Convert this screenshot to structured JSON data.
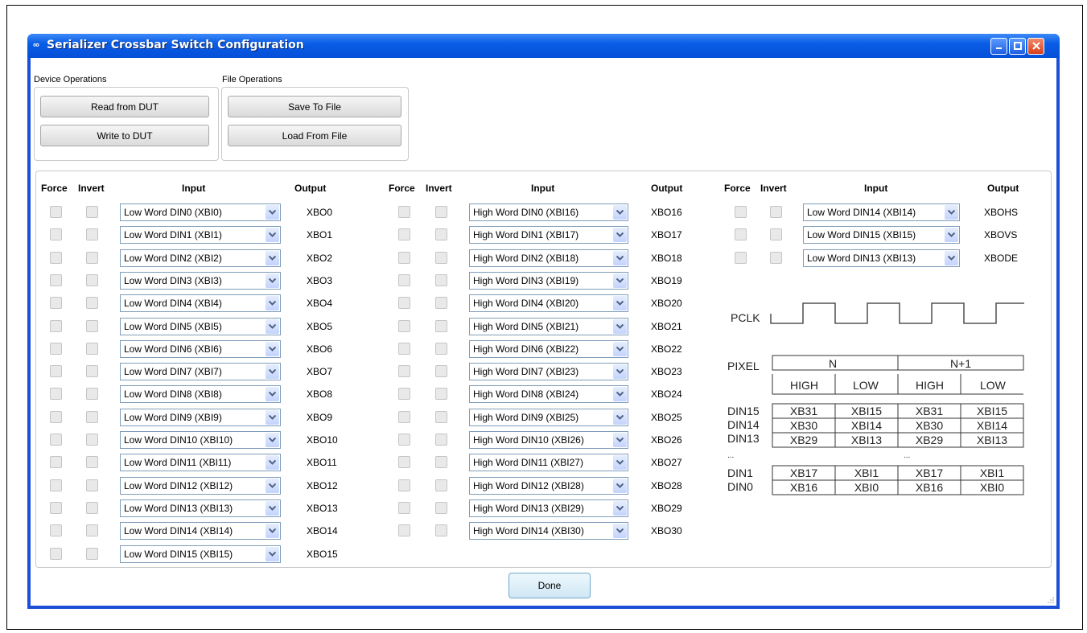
{
  "window": {
    "title": "Serializer Crossbar Switch Configuration"
  },
  "device_ops": {
    "label": "Device Operations",
    "read": "Read from DUT",
    "write": "Write to DUT"
  },
  "file_ops": {
    "label": "File Operations",
    "save": "Save To File",
    "load": "Load From File"
  },
  "headers": {
    "force": "Force",
    "invert": "Invert",
    "input": "Input",
    "output": "Output"
  },
  "col1": [
    {
      "input": "Low Word DIN0 (XBI0)",
      "output": "XBO0"
    },
    {
      "input": "Low Word DIN1 (XBI1)",
      "output": "XBO1"
    },
    {
      "input": "Low Word DIN2 (XBI2)",
      "output": "XBO2"
    },
    {
      "input": "Low Word DIN3 (XBI3)",
      "output": "XBO3"
    },
    {
      "input": "Low Word DIN4 (XBI4)",
      "output": "XBO4"
    },
    {
      "input": "Low Word DIN5 (XBI5)",
      "output": "XBO5"
    },
    {
      "input": "Low Word DIN6 (XBI6)",
      "output": "XBO6"
    },
    {
      "input": "Low Word DIN7 (XBI7)",
      "output": "XBO7"
    },
    {
      "input": "Low Word DIN8 (XBI8)",
      "output": "XBO8"
    },
    {
      "input": "Low Word DIN9 (XBI9)",
      "output": "XBO9"
    },
    {
      "input": "Low Word DIN10 (XBI10)",
      "output": "XBO10"
    },
    {
      "input": "Low Word DIN11 (XBI11)",
      "output": "XBO11"
    },
    {
      "input": "Low Word DIN12 (XBI12)",
      "output": "XBO12"
    },
    {
      "input": "Low Word DIN13 (XBI13)",
      "output": "XBO13"
    },
    {
      "input": "Low Word DIN14 (XBI14)",
      "output": "XBO14"
    },
    {
      "input": "Low Word DIN15 (XBI15)",
      "output": "XBO15"
    }
  ],
  "col2": [
    {
      "input": "High Word DIN0 (XBI16)",
      "output": "XBO16"
    },
    {
      "input": "High Word DIN1 (XBI17)",
      "output": "XBO17"
    },
    {
      "input": "High Word DIN2 (XBI18)",
      "output": "XBO18"
    },
    {
      "input": "High Word DIN3 (XBI19)",
      "output": "XBO19"
    },
    {
      "input": "High Word DIN4 (XBI20)",
      "output": "XBO20"
    },
    {
      "input": "High Word DIN5 (XBI21)",
      "output": "XBO21"
    },
    {
      "input": "High Word DIN6 (XBI22)",
      "output": "XBO22"
    },
    {
      "input": "High Word DIN7 (XBI23)",
      "output": "XBO23"
    },
    {
      "input": "High Word DIN8 (XBI24)",
      "output": "XBO24"
    },
    {
      "input": "High Word DIN9 (XBI25)",
      "output": "XBO25"
    },
    {
      "input": "High Word DIN10 (XBI26)",
      "output": "XBO26"
    },
    {
      "input": "High Word DIN11 (XBI27)",
      "output": "XBO27"
    },
    {
      "input": "High Word DIN12 (XBI28)",
      "output": "XBO28"
    },
    {
      "input": "High Word DIN13 (XBI29)",
      "output": "XBO29"
    },
    {
      "input": "High Word DIN14 (XBI30)",
      "output": "XBO30"
    }
  ],
  "col3": [
    {
      "input": "Low Word DIN14 (XBI14)",
      "output": "XBOHS"
    },
    {
      "input": "Low Word DIN15 (XBI15)",
      "output": "XBOVS"
    },
    {
      "input": "Low Word DIN13 (XBI13)",
      "output": "XBODE"
    }
  ],
  "diagram": {
    "pclk": "PCLK",
    "pixel": "PIXEL",
    "n": "N",
    "n1": "N+1",
    "halves": [
      "HIGH",
      "LOW",
      "HIGH",
      "LOW"
    ],
    "rows": [
      {
        "label": "DIN15",
        "cells": [
          "XB31",
          "XBI15",
          "XB31",
          "XBI15"
        ]
      },
      {
        "label": "DIN14",
        "cells": [
          "XB30",
          "XBI14",
          "XB30",
          "XBI14"
        ]
      },
      {
        "label": "DIN13",
        "cells": [
          "XB29",
          "XBI13",
          "XB29",
          "XBI13"
        ]
      },
      {
        "label": "DIN1",
        "cells": [
          "XB17",
          "XBI1",
          "XB17",
          "XBI1"
        ]
      },
      {
        "label": "DIN0",
        "cells": [
          "XB16",
          "XBI0",
          "XB16",
          "XBI0"
        ]
      }
    ],
    "ellipsis": "..."
  },
  "done": "Done"
}
